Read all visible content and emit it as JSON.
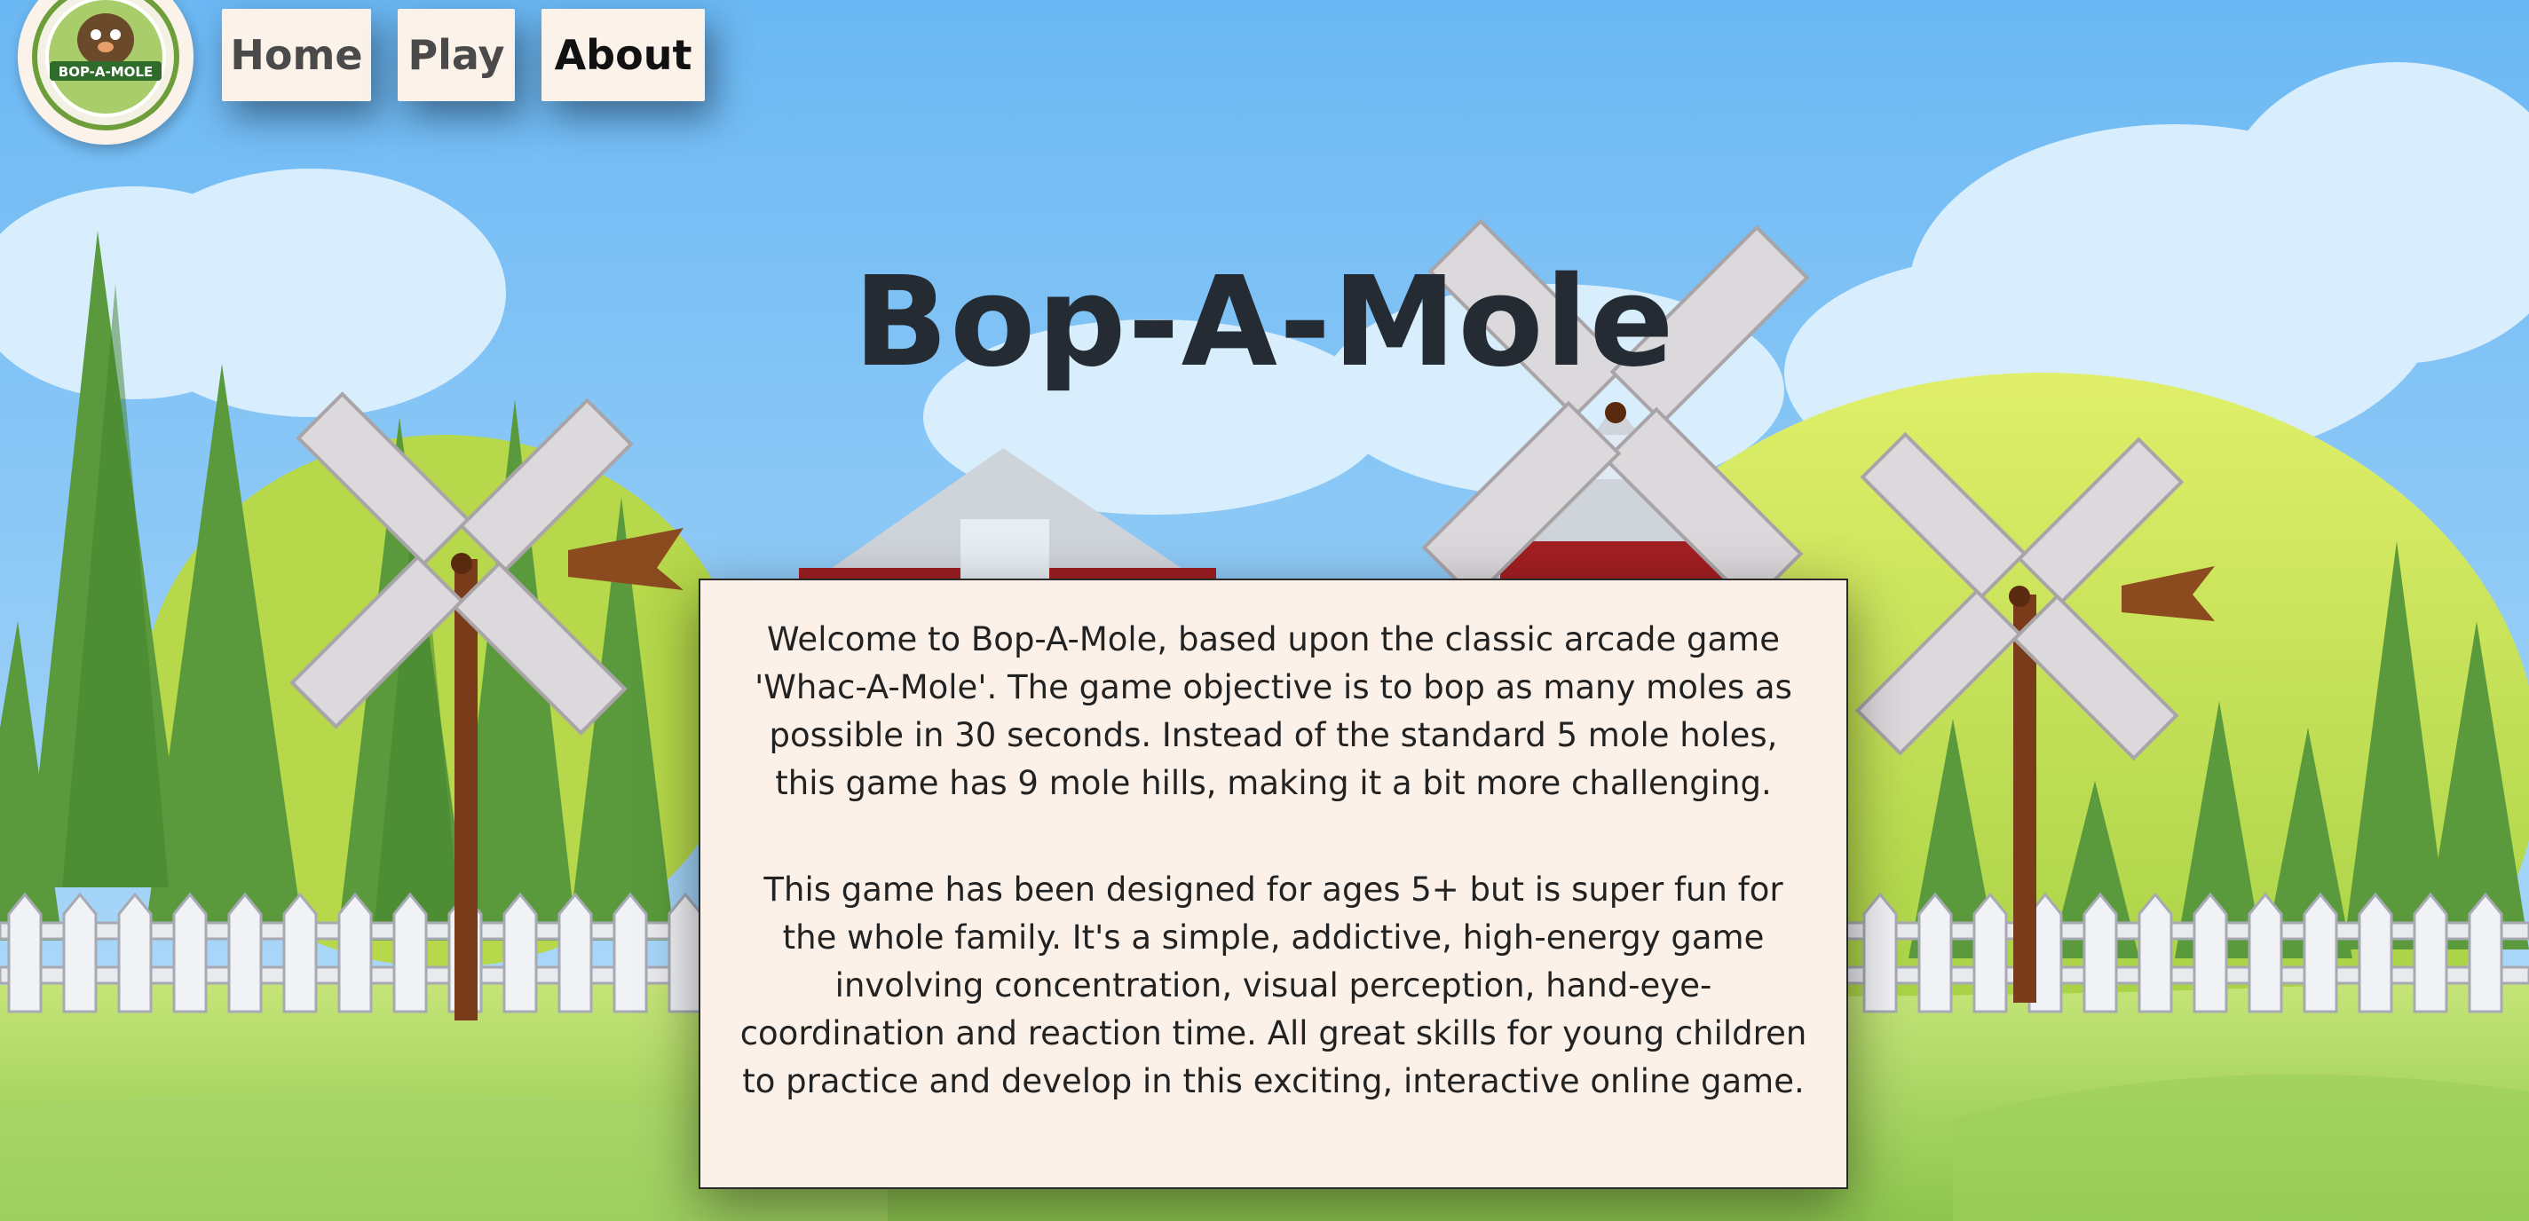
{
  "logo": {
    "text": "BOP-A-MOLE"
  },
  "nav": {
    "home": "Home",
    "play": "Play",
    "about": "About"
  },
  "page": {
    "title": "Bop-A-Mole"
  },
  "about": {
    "paragraph_1": "Welcome to Bop-A-Mole, based upon the classic arcade game 'Whac-A-Mole'. The game objective is to bop as many moles as possible in 30 seconds. Instead of the standard 5 mole holes, this game has 9 mole hills, making it a bit more challenging.",
    "paragraph_2": "This game has been designed for ages 5+ but is super fun for the whole family. It's a simple, addictive, high-energy game involving concentration, visual perception, hand-eye-coordination and reaction time. All great skills for young children to practice and develop in this exciting, interactive online game."
  },
  "colors": {
    "sky": "#6fbdf5",
    "grass": "#a8d56a",
    "card": "#fbf1e8",
    "nav_button": "#fbf3ea",
    "title": "#252b33"
  }
}
